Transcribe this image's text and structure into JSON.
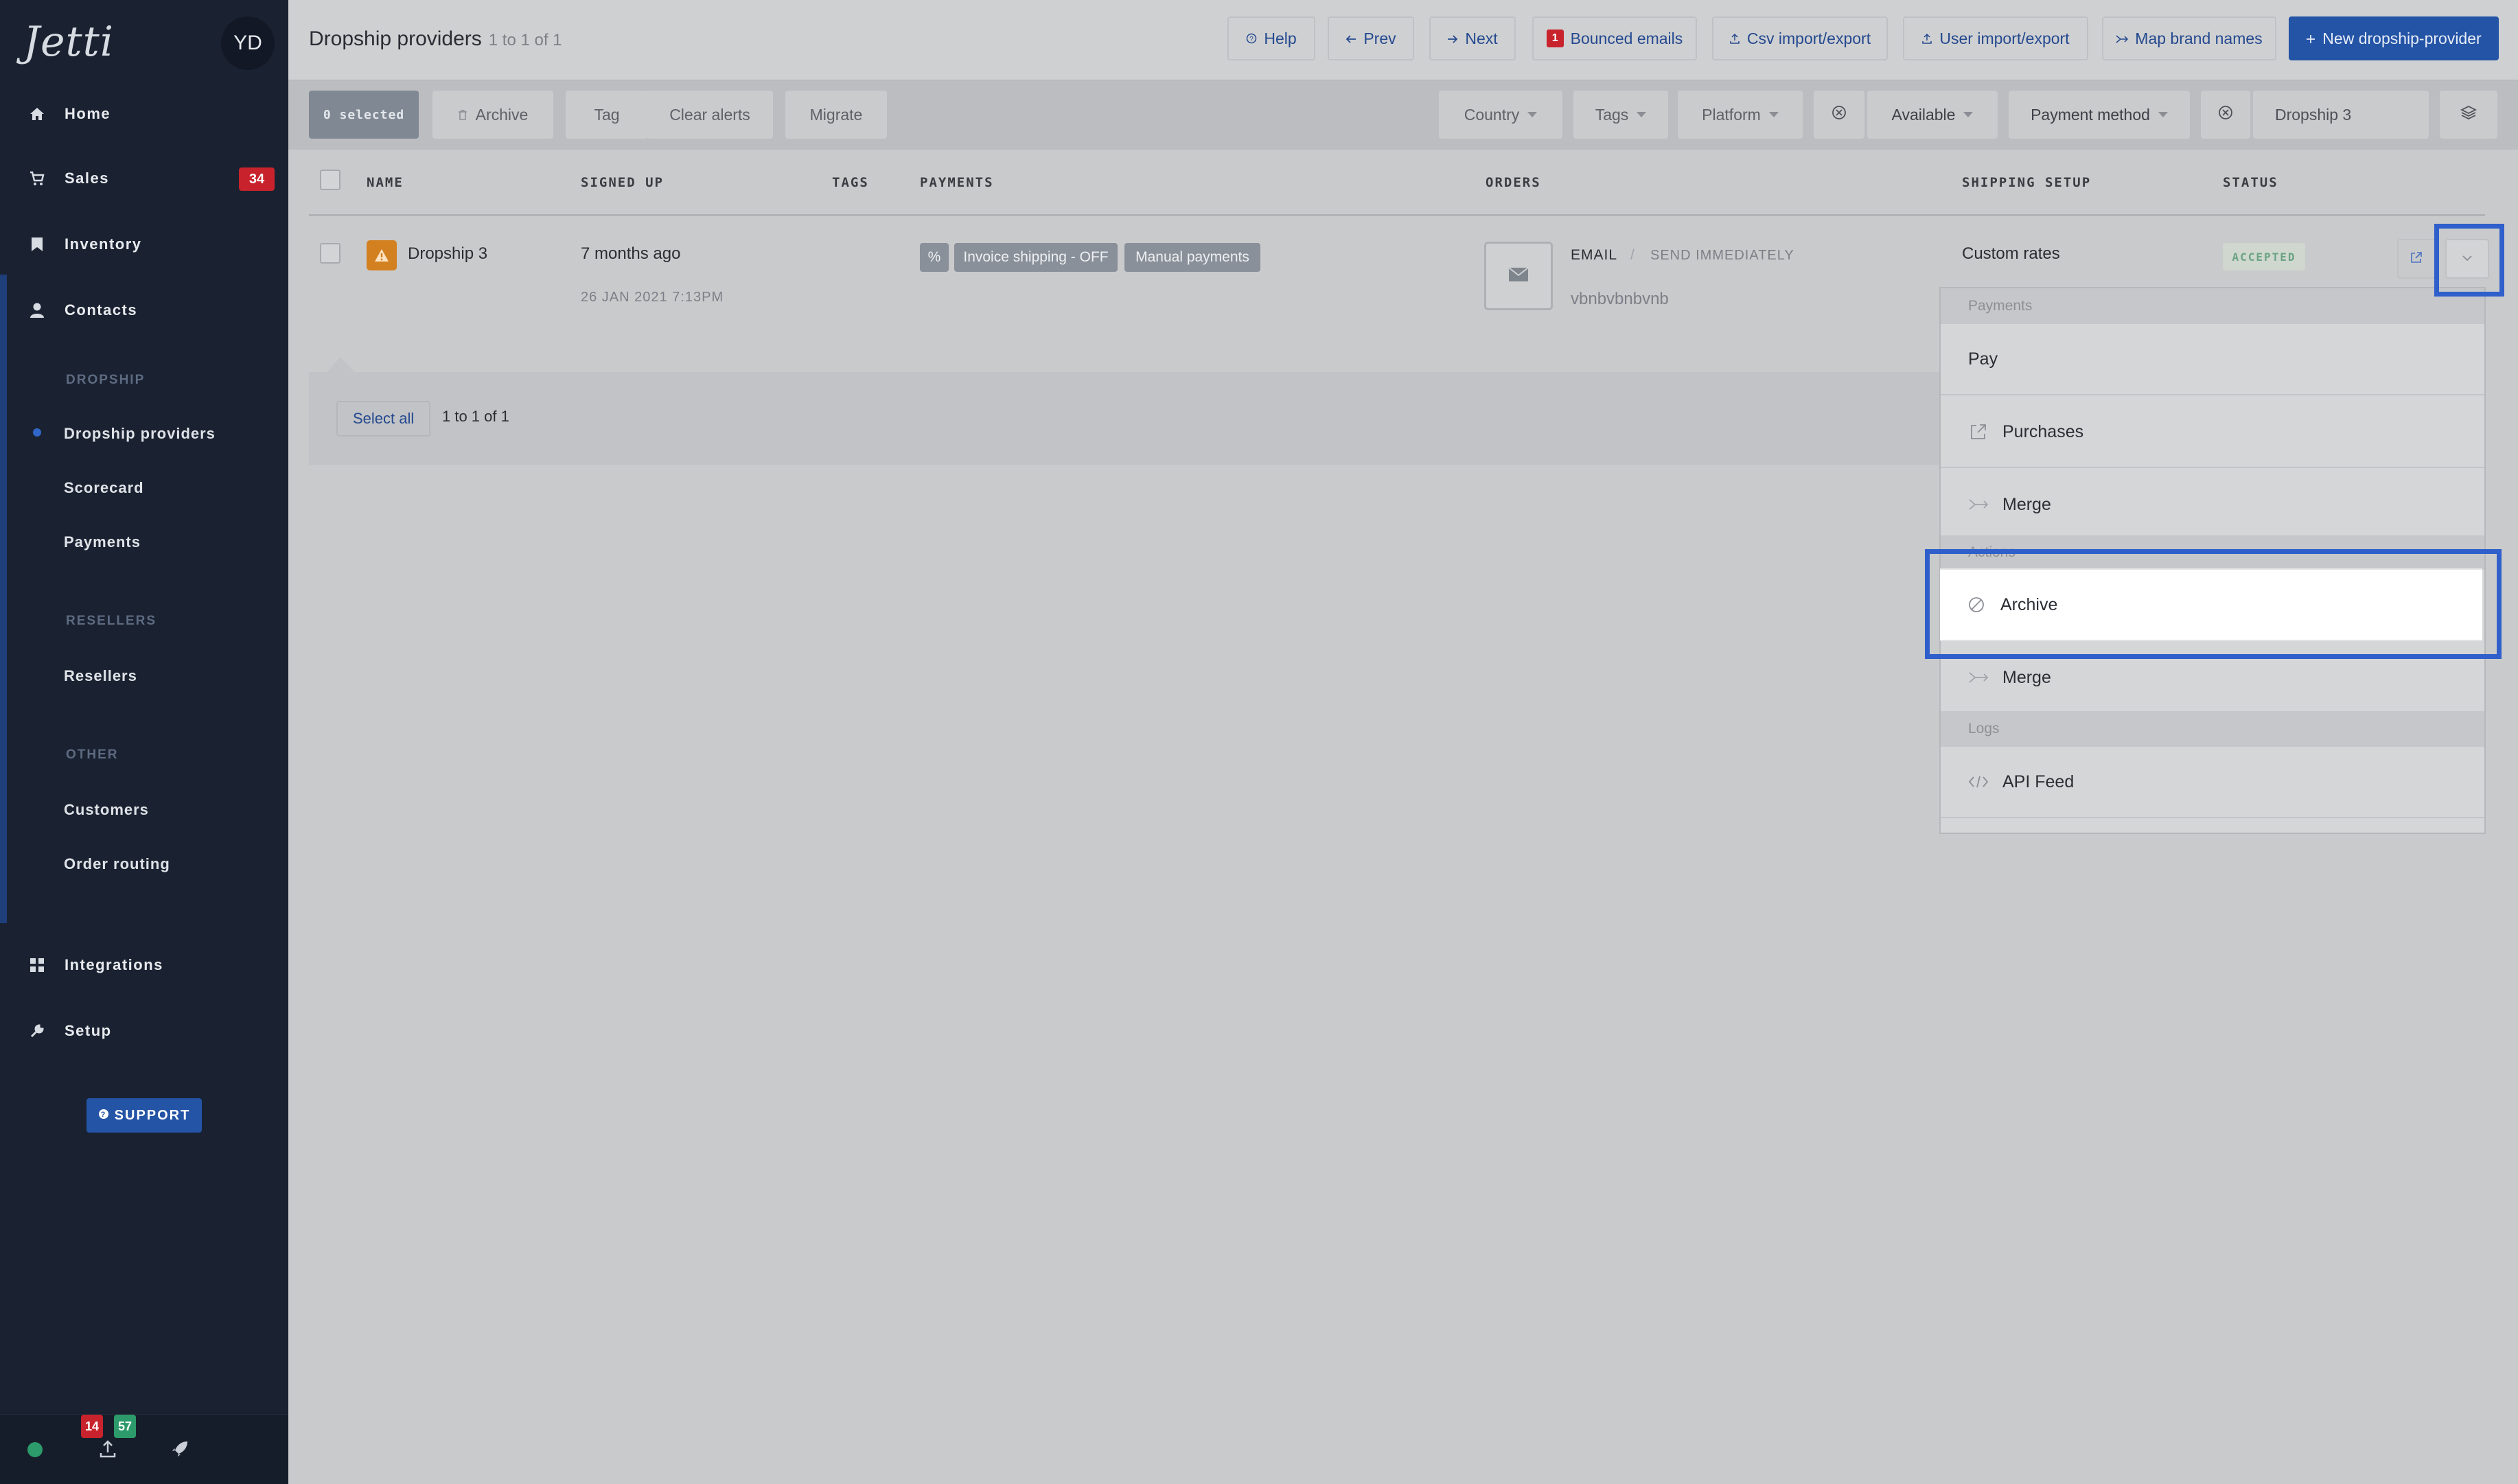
{
  "app": {
    "logo": "Jetti",
    "user_initials": "YD"
  },
  "sidebar": {
    "nav": [
      {
        "label": "Home",
        "icon": "home-icon"
      },
      {
        "label": "Sales",
        "icon": "cart-icon",
        "badge": "34"
      },
      {
        "label": "Inventory",
        "icon": "bookmark-icon"
      },
      {
        "label": "Contacts",
        "icon": "person-icon"
      }
    ],
    "sections": [
      {
        "heading": "DROPSHIP",
        "items": [
          "Dropship providers",
          "Scorecard",
          "Payments"
        ]
      },
      {
        "heading": "RESELLERS",
        "items": [
          "Resellers"
        ]
      },
      {
        "heading": "OTHER",
        "items": [
          "Customers",
          "Order routing"
        ]
      }
    ],
    "nav_bottom": [
      {
        "label": "Integrations",
        "icon": "grid-icon"
      },
      {
        "label": "Setup",
        "icon": "wrench-icon"
      }
    ],
    "support_label": "SUPPORT",
    "footer": {
      "badge_red": "14",
      "badge_green": "57"
    }
  },
  "header": {
    "title": "Dropship providers",
    "count": "1 to 1 of 1",
    "buttons": {
      "help": "Help",
      "prev": "Prev",
      "next": "Next",
      "bounced_count": "1",
      "bounced": "Bounced emails",
      "csv": "Csv import/export",
      "user_import": "User import/export",
      "map_brand": "Map brand names",
      "new_provider": "New dropship-provider"
    }
  },
  "filters": {
    "selected": "0 selected",
    "archive": "Archive",
    "tag": "Tag",
    "clear_alerts": "Clear alerts",
    "migrate": "Migrate",
    "country": "Country",
    "tags": "Tags",
    "platform": "Platform",
    "available": "Available",
    "payment_method": "Payment method",
    "search_value": "Dropship 3"
  },
  "table": {
    "headers": {
      "name": "NAME",
      "signed_up": "SIGNED UP",
      "tags": "TAGS",
      "payments": "PAYMENTS",
      "orders": "ORDERS",
      "shipping": "SHIPPING SETUP",
      "status": "STATUS"
    },
    "rows": [
      {
        "name": "Dropship 3",
        "signed_up": "7 months ago",
        "signed_up_date": "26 JAN 2021 7:13PM",
        "payment_tags": [
          "%",
          "Invoice shipping - OFF",
          "Manual payments"
        ],
        "order_method": "EMAIL",
        "order_timing": "SEND IMMEDIATELY",
        "order_email": "vbnbvbnbvnb",
        "shipping": "Custom rates",
        "status": "ACCEPTED"
      }
    ]
  },
  "pager": {
    "select_all": "Select all",
    "count": "1 to 1 of 1"
  },
  "dropdown": {
    "group_payments": "Payments",
    "pay": "Pay",
    "purchases": "Purchases",
    "merge_1": "Merge",
    "group_actions": "Actions",
    "archive": "Archive",
    "merge_2": "Merge",
    "group_logs": "Logs",
    "api_feed": "API Feed"
  },
  "colors": {
    "brand_blue": "#2454a6",
    "focus_outline": "#2f5fcb",
    "badge_red": "#c8232c",
    "badge_green": "#2c9a6a",
    "warning_orange": "#d38020"
  }
}
